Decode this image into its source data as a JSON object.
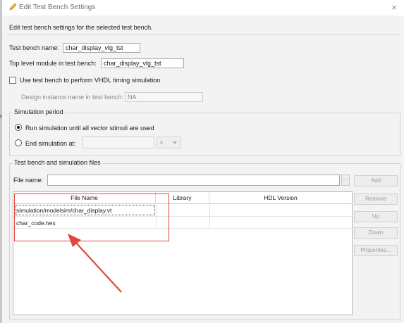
{
  "window": {
    "title": "Edit Test Bench Settings",
    "close_glyph": "×"
  },
  "description": "Edit test bench settings for the selected test bench.",
  "testbench": {
    "name_label": "Test bench name:",
    "name_value": "char_display_vlg_tst",
    "toplevel_label": "Top level module in test bench:",
    "toplevel_value": "char_display_vlg_tst",
    "vhdl_checkbox_label": "Use test bench to perform VHDL timing simulation",
    "vhdl_checked": false,
    "design_instance_label": "Design instance name in test bench:",
    "design_instance_value": "NA"
  },
  "simulation_period": {
    "title": "Simulation period",
    "run_all_label": "Run simulation until all vector stimuli are used",
    "end_at_label": "End simulation at:",
    "end_at_value": "",
    "unit": "s",
    "selected": "run_all"
  },
  "files": {
    "title": "Test bench and simulation files",
    "file_name_label": "File name:",
    "file_name_value": "",
    "browse_glyph": "...",
    "buttons": {
      "add": "Add",
      "remove": "Remove",
      "up": "Up",
      "down": "Down",
      "properties": "Properties..."
    },
    "columns": [
      "File Name",
      "Library",
      "HDL Version"
    ],
    "rows": [
      {
        "file": "simulation/modelsim/char_display.vt",
        "library": "",
        "hdl": ""
      },
      {
        "file": "char_code.hex",
        "library": "",
        "hdl": ""
      }
    ]
  },
  "side_marker": "m",
  "colors": {
    "annotation": "#e2463b",
    "disabled_text": "#9d9d9d"
  }
}
